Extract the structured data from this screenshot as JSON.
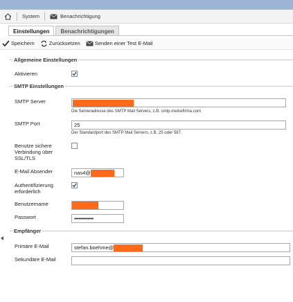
{
  "breadcrumb": {
    "system_label": "System",
    "notification_label": "Benachrichtigung"
  },
  "tabs": [
    {
      "label": "Einstellungen",
      "active": true
    },
    {
      "label": "Benachrichtigungen",
      "active": false
    }
  ],
  "toolbar": {
    "save_label": "Speichern",
    "reset_label": "Zurücksetzen",
    "test_mail_label": "Senden einer Test E-Mail"
  },
  "general": {
    "legend": "Allgemeine Einstellungen",
    "activate_label": "Aktivieren",
    "activate_checked": true
  },
  "smtp": {
    "legend": "SMTP Einstellungen",
    "server_label": "SMTP Server",
    "server_value": "",
    "server_hint": "Die Serveradresse des SMTP Mail Servers, z.B. smtp.meinefirma.com",
    "port_label": "SMTP Port",
    "port_value": "25",
    "port_hint": "Der Standardport des SMTP Mail Servers, z.B. 25 oder 587.",
    "secure_label": "Benutze sichere Verbindung über SSL/TLS",
    "secure_checked": false,
    "sender_label": "E-Mail Absender",
    "sender_value": "nas4@",
    "auth_label": "Authentifizierung erforderlich",
    "auth_checked": true,
    "username_label": "Benutzername",
    "username_value": "",
    "password_label": "Passwort",
    "password_value": "•••••••••••••"
  },
  "recipients": {
    "legend": "Empfänger",
    "primary_label": "Primäre E-Mail",
    "primary_value": "stefan.boehme@",
    "secondary_label": "Sekundäre E-Mail",
    "secondary_value": ""
  },
  "colors": {
    "redaction": "#ff6a1a",
    "topbar": "#9db5d5"
  },
  "icons": [
    "home-icon",
    "mail-icon",
    "save-check-icon",
    "reset-arrows-icon",
    "test-mail-icon",
    "checkbox-check-icon"
  ]
}
